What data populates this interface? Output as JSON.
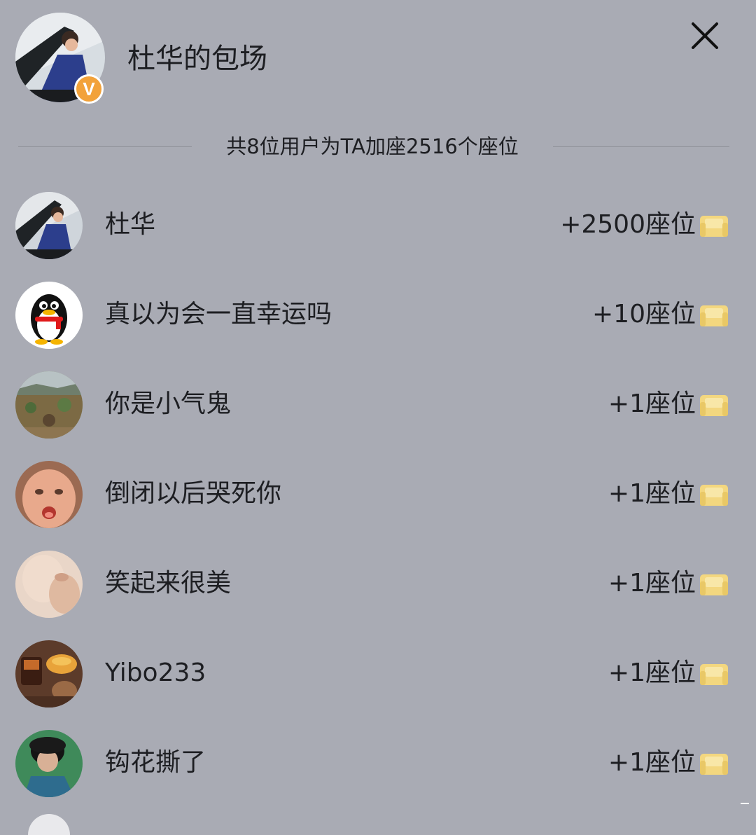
{
  "header": {
    "title": "杜华的包场",
    "verified_mark": "V",
    "close_icon": "close-icon"
  },
  "summary": {
    "text": "共8位用户为TA加座2516个座位"
  },
  "supporters": [
    {
      "name": "杜华",
      "seats": "+2500座位",
      "avatar": "photo-avatar"
    },
    {
      "name": "真以为会一直幸运吗",
      "seats": "+10座位",
      "avatar": "penguin-avatar"
    },
    {
      "name": "你是小气鬼",
      "seats": "+1座位",
      "avatar": "landscape-avatar"
    },
    {
      "name": "倒闭以后哭死你",
      "seats": "+1座位",
      "avatar": "child-face-avatar"
    },
    {
      "name": "笑起来很美",
      "seats": "+1座位",
      "avatar": "hand-photo-avatar"
    },
    {
      "name": "Yibo233",
      "seats": "+1座位",
      "avatar": "food-photo-avatar"
    },
    {
      "name": "钩花撕了",
      "seats": "+1座位",
      "avatar": "person-photo-avatar"
    }
  ],
  "colors": {
    "background": "#a9abb4",
    "text": "#1d1e22",
    "badge": "#f2a23a",
    "seat_icon": "#f3d77f"
  }
}
